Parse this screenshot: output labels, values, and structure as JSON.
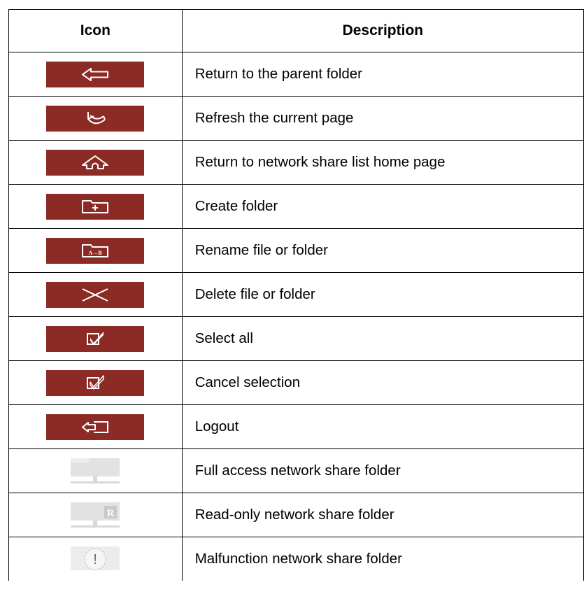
{
  "headers": {
    "icon": "Icon",
    "description": "Description"
  },
  "colors": {
    "accent": "#8c2b26",
    "icon_stroke": "#ffffff",
    "share_icon": "#dddddd"
  },
  "rows": [
    {
      "icon": "back-arrow-icon",
      "description": "Return to the parent folder"
    },
    {
      "icon": "refresh-icon",
      "description": "Refresh the current page"
    },
    {
      "icon": "home-icon",
      "description": "Return to network share list home page"
    },
    {
      "icon": "create-folder-icon",
      "description": "Create folder"
    },
    {
      "icon": "rename-icon",
      "icon_text": "A→B",
      "description": "Rename file or folder"
    },
    {
      "icon": "delete-icon",
      "description": "Delete file or folder"
    },
    {
      "icon": "select-all-icon",
      "description": "Select all"
    },
    {
      "icon": "cancel-selection-icon",
      "description": "Cancel selection"
    },
    {
      "icon": "logout-icon",
      "description": "Logout"
    },
    {
      "icon": "full-access-share-folder-icon",
      "description": "Full access network share folder"
    },
    {
      "icon": "read-only-share-folder-icon",
      "icon_text": "R",
      "description": "Read-only network share folder"
    },
    {
      "icon": "malfunction-share-folder-icon",
      "icon_text": "!",
      "description": "Malfunction network share folder"
    }
  ]
}
